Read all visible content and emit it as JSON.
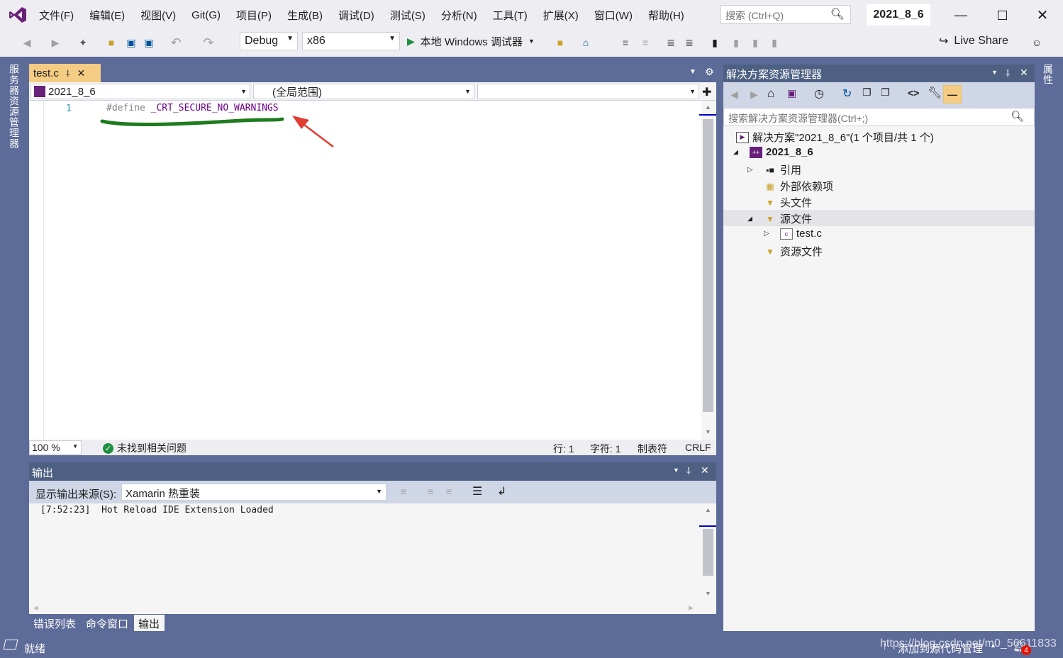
{
  "menu": [
    "文件(F)",
    "编辑(E)",
    "视图(V)",
    "Git(G)",
    "项目(P)",
    "生成(B)",
    "调试(D)",
    "测试(S)",
    "分析(N)",
    "工具(T)",
    "扩展(X)",
    "窗口(W)",
    "帮助(H)"
  ],
  "search": {
    "placeholder": "搜索 (Ctrl+Q)"
  },
  "solution_name": "2021_8_6",
  "toolbar": {
    "config": "Debug",
    "platform": "x86",
    "debugger": "本地 Windows 调试器",
    "live_share": "Live Share"
  },
  "editor": {
    "tab_label": "test.c",
    "nav_project": "2021_8_6",
    "nav_scope": "(全局范围)",
    "line_number": "1",
    "code_keyword": "#define",
    "code_macro": "_CRT_SECURE_NO_WARNINGS",
    "zoom": "100 %",
    "issues": "未找到相关问题",
    "row": "行: 1",
    "char": "字符: 1",
    "tabs": "制表符",
    "eol": "CRLF"
  },
  "output": {
    "title": "输出",
    "source_label": "显示输出来源(S):",
    "source_value": "Xamarin 热重装",
    "log": "[7:52:23]  Hot Reload IDE Extension Loaded"
  },
  "bottom_tabs": [
    "错误列表",
    "命令窗口",
    "输出"
  ],
  "solution_explorer": {
    "title": "解决方案资源管理器",
    "search_placeholder": "搜索解决方案资源管理器(Ctrl+;)",
    "solution": "解决方案\"2021_8_6\"(1 个项目/共 1 个)",
    "project": "2021_8_6",
    "references": "引用",
    "external_deps": "外部依赖项",
    "headers": "头文件",
    "sources": "源文件",
    "source_file": "test.c",
    "resources": "资源文件"
  },
  "side_left": "服务器资源管理器",
  "side_right": "属性",
  "status": {
    "ready": "就绪",
    "add_source": "添加到源代码管理",
    "watermark": "https://blog.csdn.net/m0_56611833",
    "notif_count": "4"
  },
  "colors": {
    "accent": "#68217A",
    "editor_tab": "#F5CC84",
    "panel_header": "#4D6082",
    "annotation_underline": "#1E7B1E",
    "annotation_arrow": "#E03C31"
  }
}
